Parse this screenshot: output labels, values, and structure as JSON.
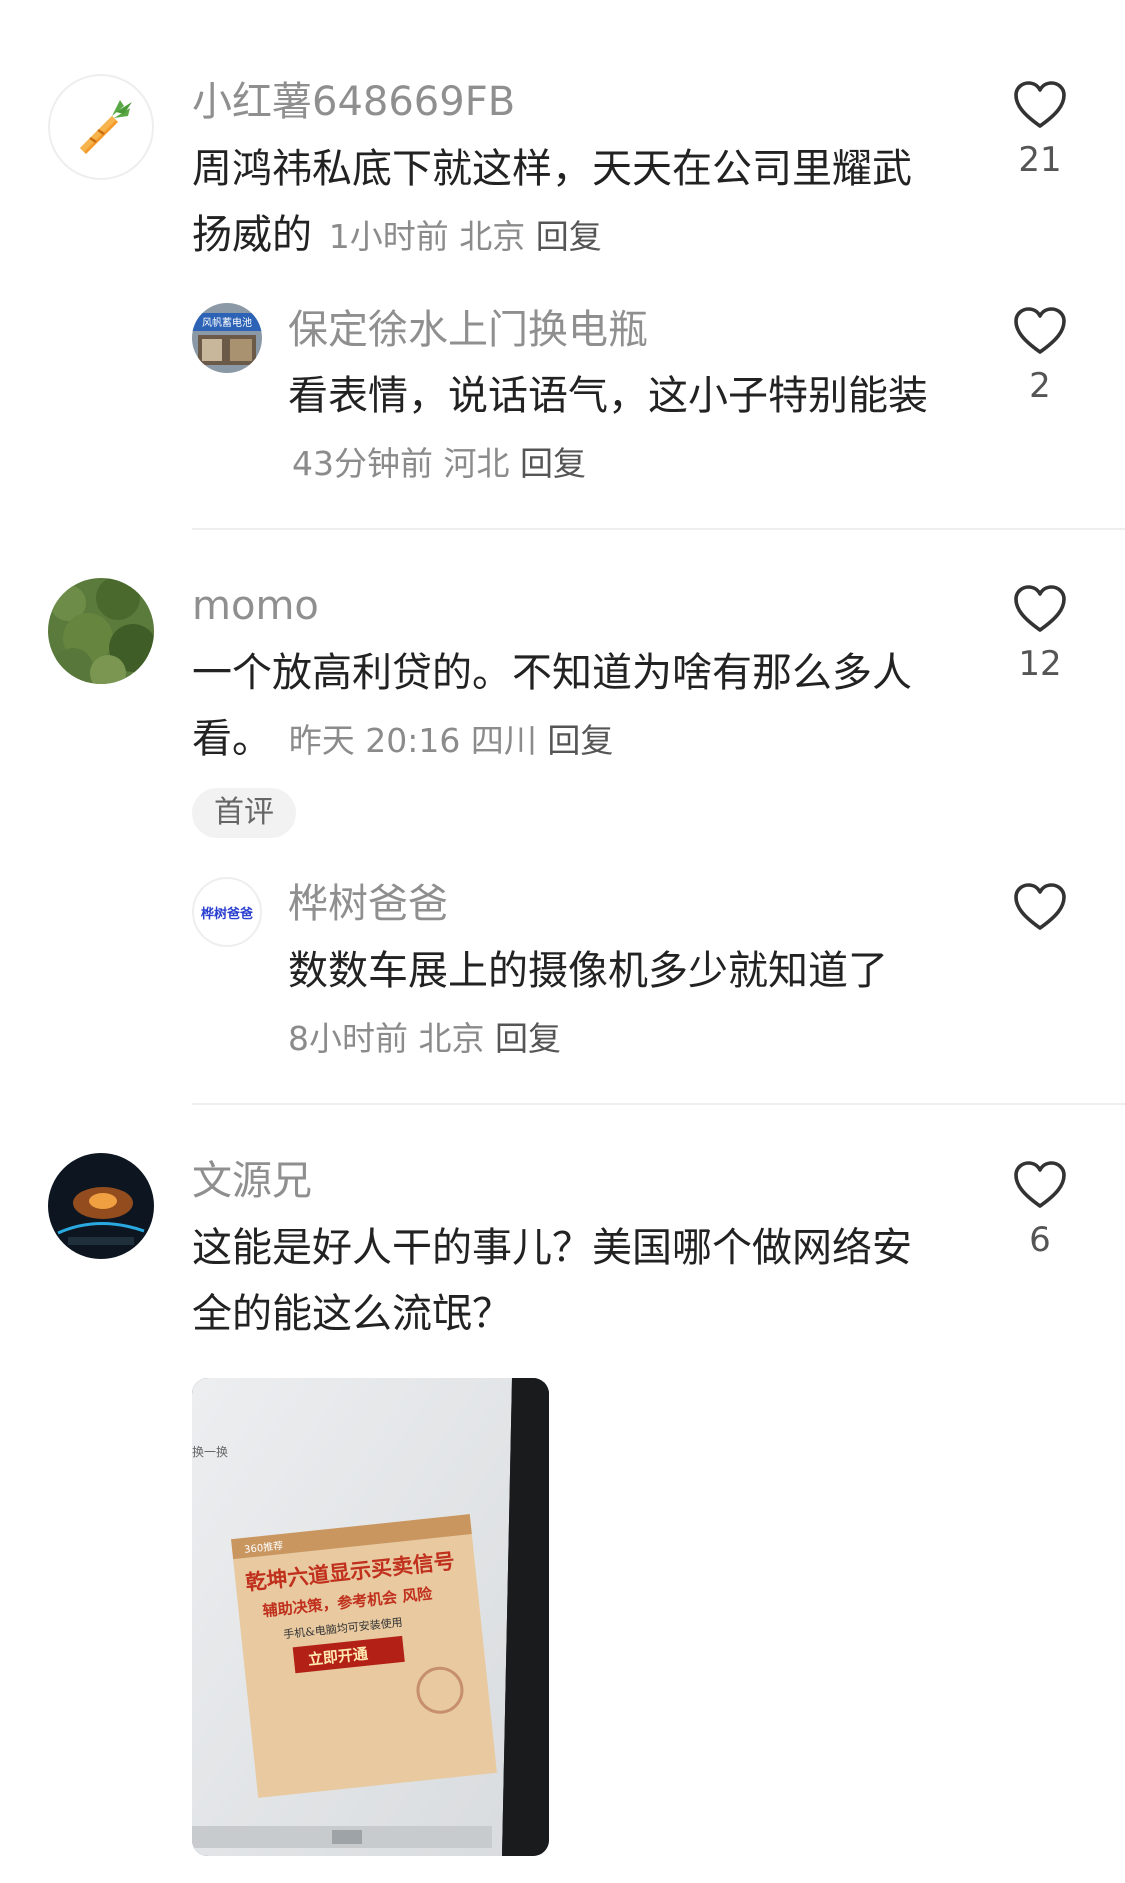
{
  "comments": [
    {
      "username": "小红薯648669FB",
      "text": "周鸿祎私底下就这样，天天在公司里耀武扬威的",
      "time": "1小时前",
      "location": "北京",
      "reply_label": "回复",
      "likes": "21",
      "avatar_icon": "carrot-icon",
      "replies": [
        {
          "username": "保定徐水上门换电瓶",
          "text": "看表情，说话语气，这小子特别能装",
          "time": "43分钟前",
          "location": "河北",
          "reply_label": "回复",
          "likes": "2",
          "avatar_icon": "shop-avatar-icon",
          "avatar_sign": "风帆蓄电池"
        }
      ]
    },
    {
      "username": "momo",
      "text": "一个放高利贷的。不知道为啥有那么多人看。",
      "time": "昨天 20:16",
      "location": "四川",
      "reply_label": "回复",
      "likes": "12",
      "badge": "首评",
      "avatar_icon": "forest-avatar-icon",
      "replies": [
        {
          "username": "桦树爸爸",
          "text": "数数车展上的摄像机多少就知道了",
          "time": "8小时前",
          "location": "北京",
          "reply_label": "回复",
          "likes": "",
          "avatar_icon": "text-avatar-icon",
          "avatar_text": "桦树爸爸"
        }
      ]
    },
    {
      "username": "文源兄",
      "text": "这能是好人干的事儿？美国哪个做网络安全的能这么流氓？",
      "likes": "6",
      "avatar_icon": "car-night-avatar-icon",
      "attachment": {
        "corner_text": "换一换",
        "ad_tag": "360推荐",
        "headline": "乾坤六道显示买卖信号",
        "subline": "辅助决策，参考机会 风险",
        "smallline": "手机&电脑均可安装使用",
        "button": "立即开通"
      }
    }
  ],
  "colors": {
    "username": "#8f8f8f",
    "text": "#222222",
    "meta": "#8b8b8b",
    "badge_bg": "#f2f2f2"
  }
}
